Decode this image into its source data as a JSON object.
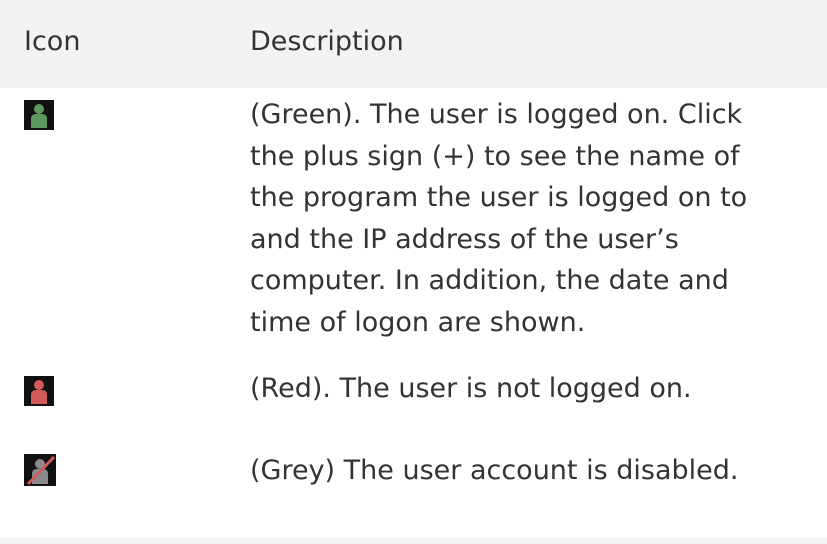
{
  "table": {
    "headers": {
      "icon": "Icon",
      "description": "Description"
    },
    "rows": [
      {
        "icon": "user-green-icon",
        "icon_color": "#5e9a5e",
        "description": "(Green). The user is logged on. Click\nthe plus sign (+) to see the name of\nthe program the user is logged on to\nand the IP address of the user’s\ncomputer. In addition, the date and\ntime of logon are shown."
      },
      {
        "icon": "user-red-icon",
        "icon_color": "#d45a5a",
        "description": "(Red). The user is not logged on."
      },
      {
        "icon": "user-disabled-icon",
        "icon_color": "#8a8a8a",
        "slash_color": "#d45a5a",
        "description": "(Grey) The user account is disabled."
      }
    ]
  },
  "colors": {
    "header_bg": "#f3f3f3",
    "text": "#333333",
    "icon_bg": "#111111"
  }
}
